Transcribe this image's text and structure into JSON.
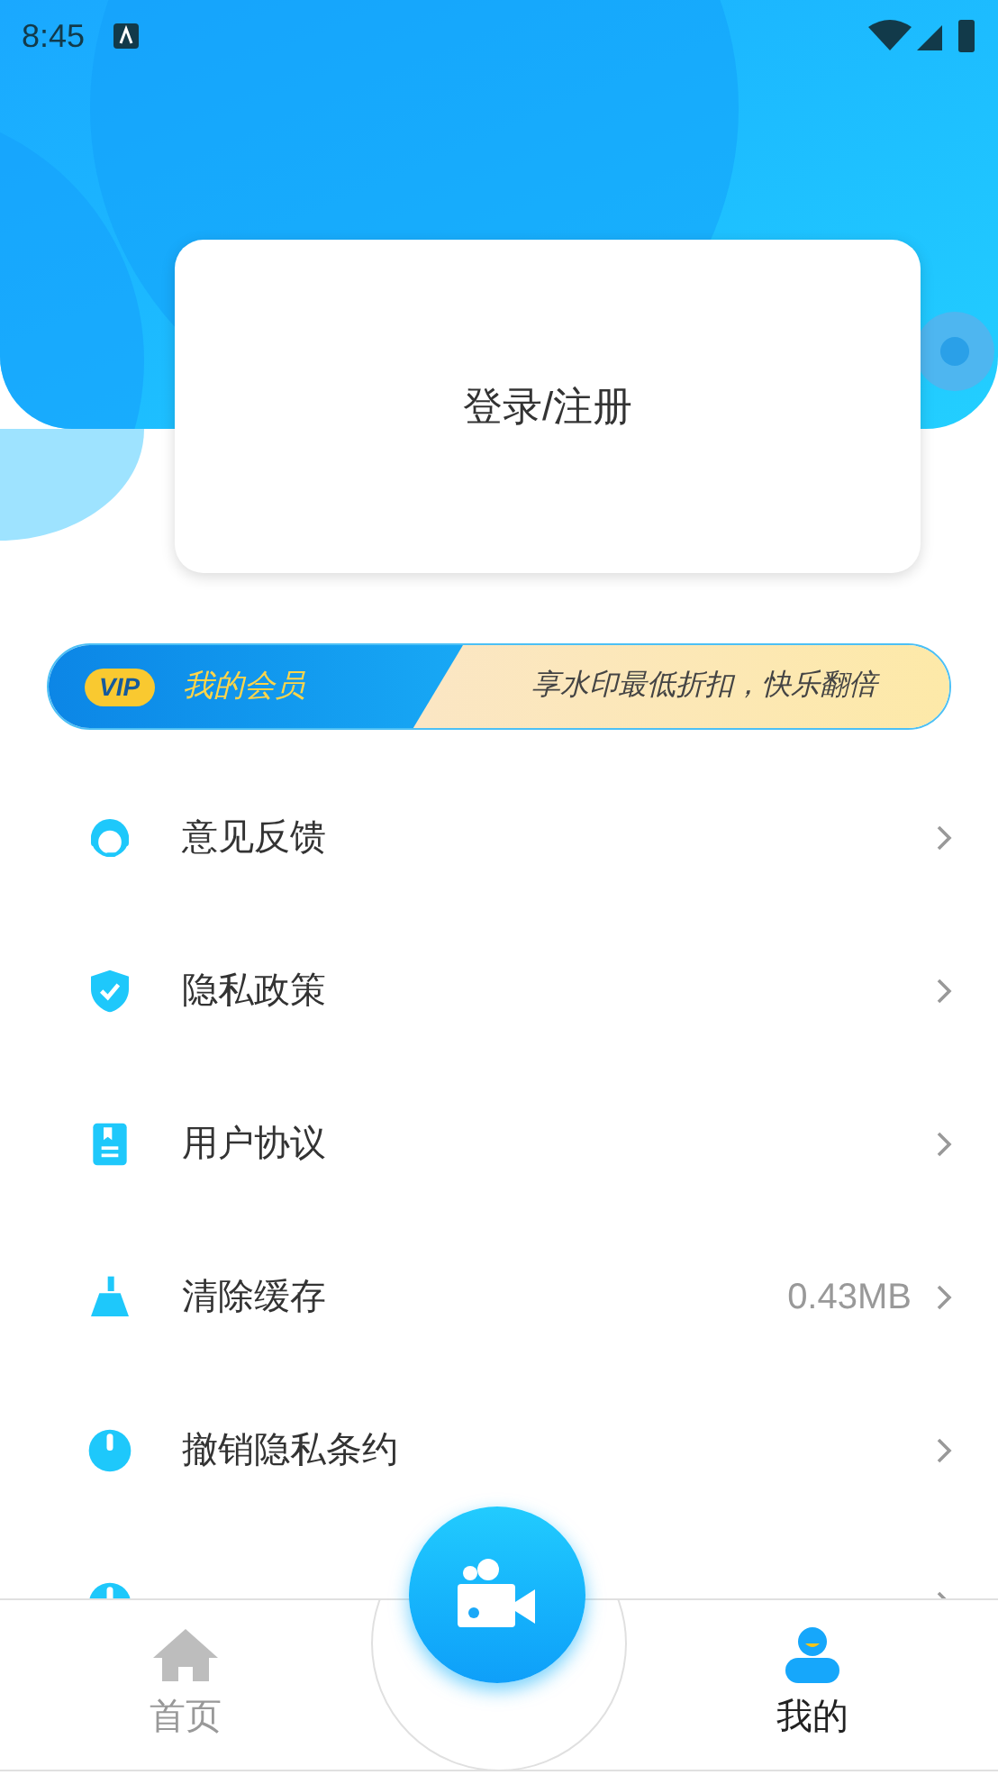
{
  "status_bar": {
    "time": "8:45"
  },
  "login_card": {
    "label": "登录/注册"
  },
  "vip_banner": {
    "badge": "VIP",
    "title": "我的会员",
    "slogan": "享水印最低折扣，快乐翻倍"
  },
  "menu": [
    {
      "kind": "headset",
      "label": "意见反馈"
    },
    {
      "kind": "shield",
      "label": "隐私政策"
    },
    {
      "kind": "document",
      "label": "用户协议"
    },
    {
      "kind": "broom",
      "label": "清除缓存",
      "value": "0.43MB"
    },
    {
      "kind": "power",
      "label": "撤销隐私条约"
    },
    {
      "kind": "power"
    }
  ],
  "bottom_nav": [
    {
      "kind": "home",
      "label": "首页",
      "selected": false
    },
    {
      "kind": "camera"
    },
    {
      "kind": "user",
      "label": "我的",
      "selected": true
    }
  ]
}
